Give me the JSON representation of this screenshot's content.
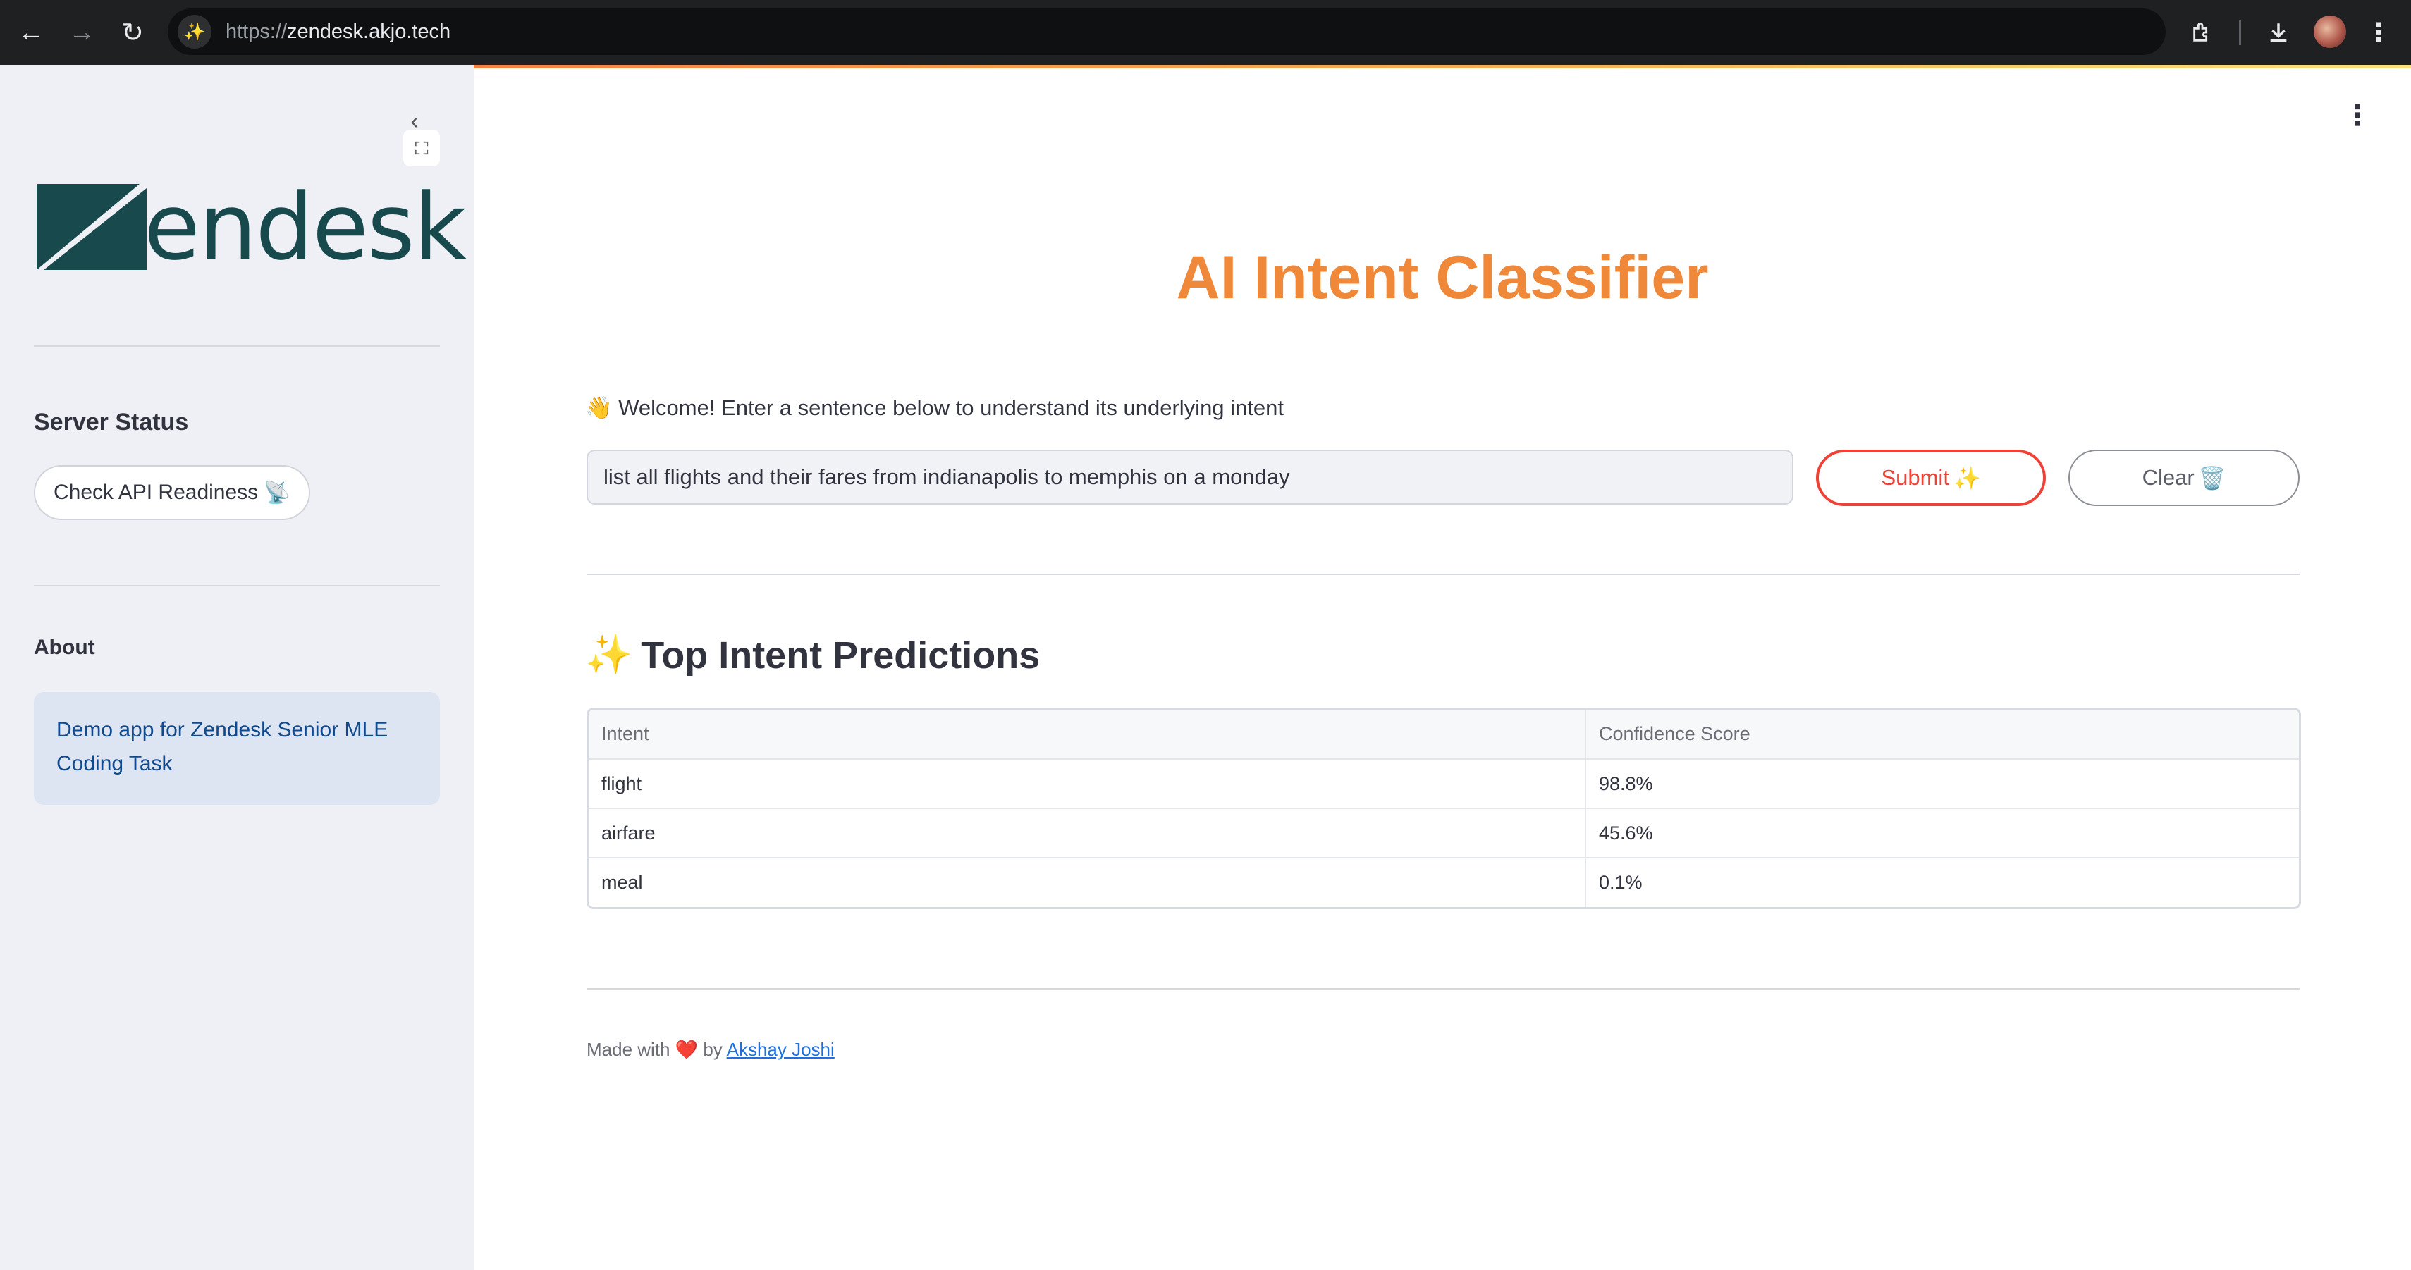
{
  "browser": {
    "url_scheme": "https://",
    "url_host": "zendesk.akjo.tech",
    "site_icon": "sparkles-icon",
    "back_icon": "←",
    "forward_icon": "→",
    "reload_icon": "↻"
  },
  "sidebar": {
    "logo_text": "endesk",
    "server_status_heading": "Server Status",
    "check_api_label": "Check API Readiness",
    "check_api_emoji": "📡",
    "about_heading": "About",
    "about_text": "Demo app for Zendesk Senior MLE Coding Task"
  },
  "main": {
    "title": "AI Intent Classifier",
    "welcome_emoji": "👋",
    "welcome_text": "Welcome! Enter a sentence below to understand its underlying intent",
    "query_value": "list all flights and their fares from indianapolis to memphis on a monday",
    "submit_label": "Submit",
    "submit_emoji": "✨",
    "clear_label": "Clear",
    "clear_emoji": "🗑️",
    "predictions_emoji": "✨",
    "predictions_heading": "Top Intent Predictions",
    "table": {
      "columns": [
        "Intent",
        "Confidence Score"
      ],
      "rows": [
        [
          "flight",
          "98.8%"
        ],
        [
          "airfare",
          "45.6%"
        ],
        [
          "meal",
          "0.1%"
        ]
      ]
    },
    "footer": {
      "prefix": "Made with",
      "heart": "❤️",
      "by": "by",
      "author": "Akshay Joshi"
    }
  },
  "colors": {
    "accent": "#f0883a",
    "submit": "#ef4135",
    "logo": "#17494d",
    "info_bg": "#dde4f2",
    "info_text": "#104a8e"
  }
}
